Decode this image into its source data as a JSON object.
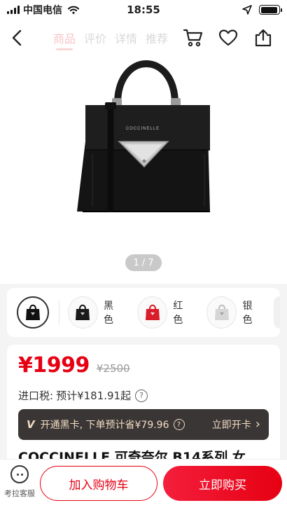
{
  "status_bar": {
    "carrier": "中国电信",
    "time": "18:55",
    "battery_level": 0.92
  },
  "nav": {
    "tabs": [
      {
        "label": "商品",
        "active": true
      },
      {
        "label": "评价",
        "active": false
      },
      {
        "label": "详情",
        "active": false
      },
      {
        "label": "推荐",
        "active": false
      }
    ],
    "icons": [
      "back-icon",
      "cart-icon",
      "heart-icon",
      "share-icon"
    ]
  },
  "gallery": {
    "brand_on_bag": "COCCINELLE",
    "pager": "1 / 7",
    "current_image": 1,
    "total_images": 7
  },
  "variants": [
    {
      "label": "",
      "color": "#111111",
      "selected": true
    },
    {
      "label": "黑色",
      "color": "#1a1a1a",
      "selected": false
    },
    {
      "label": "红色",
      "color": "#d91d2a",
      "selected": false
    },
    {
      "label": "银色",
      "color": "#cfcfcf",
      "selected": false
    }
  ],
  "price": {
    "current": "¥1999",
    "original": "¥2500",
    "tax_label": "进口税:",
    "tax_value": "预计¥181.91起",
    "help_icon": "?"
  },
  "membership": {
    "mark": "V",
    "text": "开通黑卡, 下单预计省¥79.96",
    "help_icon": "?",
    "cta": "立即开卡",
    "cta_arrow": "›"
  },
  "product_title_peek": "COCCINELLE 可奇奈尔 B14系列 女",
  "bottom_bar": {
    "service_label": "考拉客服",
    "add_to_cart": "加入购物车",
    "buy_now": "立即购买"
  },
  "colors": {
    "accent": "#e60012",
    "member_bar_bg": "#3a3636",
    "member_text": "#f2dcc3"
  }
}
